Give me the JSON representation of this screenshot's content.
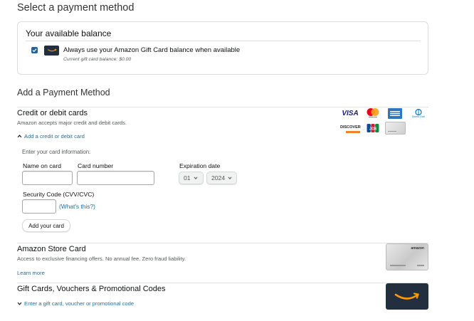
{
  "page": {
    "title": "Select a payment method"
  },
  "balance": {
    "title": "Your available balance",
    "always_use_label": "Always use your Amazon Gift Card balance when available",
    "always_use_checked": true,
    "current_balance": "Current gift card balance: $0.00"
  },
  "add_payment": {
    "heading": "Add a Payment Method"
  },
  "cards": {
    "title": "Credit or debit cards",
    "subtitle": "Amazon accepts major credit and debit cards.",
    "add_link": "Add a credit or debit card",
    "enter_info": "Enter your card information:",
    "name_label": "Name on card",
    "number_label": "Card number",
    "exp_label": "Expiration date",
    "exp_month": "01",
    "exp_year": "2024",
    "cvv_label": "Security Code (CVV/CVC)",
    "whats_this": "(What's this?)",
    "add_button": "Add your card",
    "logos": {
      "visa": "VISA",
      "discover": "DISCOVER",
      "jcb": "JCB",
      "diners": "Diners Club",
      "colors": {
        "visa": "#1a1f71",
        "mastercard_red": "#eb001b",
        "mastercard_yellow": "#f79e1b",
        "amex": "#2e77bc",
        "discover_orange": "#f58220"
      }
    }
  },
  "store_card": {
    "title": "Amazon Store Card",
    "subtitle": "Access to exclusive financing offers. No annual fee. Zero fraud liability.",
    "learn_more": "Learn more",
    "card_brand": "amazon"
  },
  "gift": {
    "title": "Gift Cards, Vouchers & Promotional Codes",
    "enter_link": "Enter a gift card, voucher or promotional code"
  },
  "colors": {
    "link": "#2a6d94",
    "checkbox": "#2162a1",
    "amazon_navy": "#232f3e",
    "amazon_orange": "#ff9900"
  }
}
